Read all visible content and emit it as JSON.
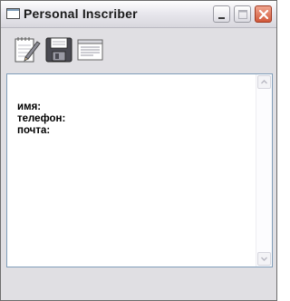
{
  "window": {
    "title": "Personal Inscriber"
  },
  "titlebar": {
    "icons": [
      "window-app-icon",
      "minimize-icon",
      "maximize-icon",
      "close-icon"
    ]
  },
  "toolbar": {
    "items": [
      {
        "icon": "notepad-pencil-icon"
      },
      {
        "icon": "floppy-save-icon"
      },
      {
        "icon": "document-icon"
      }
    ]
  },
  "editor": {
    "lines": [
      "имя:",
      "телефон:",
      "почта:"
    ]
  },
  "colors": {
    "close_button": "#d1583a",
    "editor_border": "#7f9db9"
  }
}
